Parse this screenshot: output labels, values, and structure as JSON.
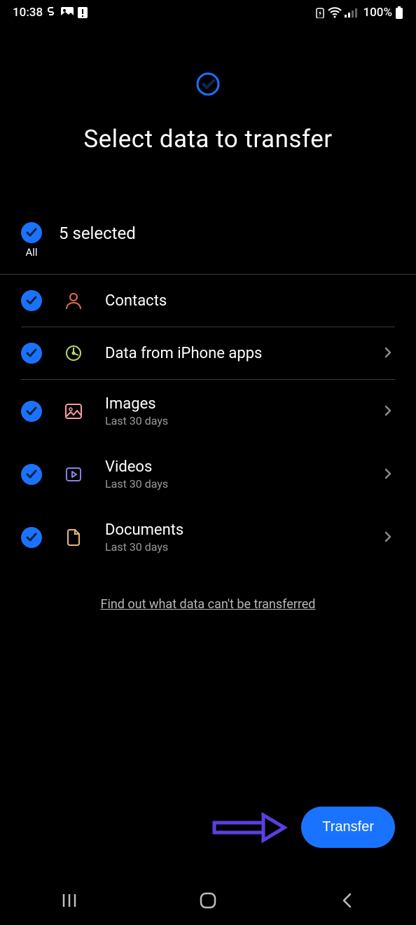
{
  "status": {
    "time": "10:38",
    "battery": "100%"
  },
  "header": {
    "title": "Select data to transfer"
  },
  "all": {
    "label": "All",
    "selected_text": "5 selected"
  },
  "items": [
    {
      "title": "Contacts",
      "sub": "",
      "chevron": false,
      "divider": true,
      "icon_color": "#e06c4e"
    },
    {
      "title": "Data from iPhone apps",
      "sub": "",
      "chevron": true,
      "divider": true,
      "icon_color": "#b8d96a"
    },
    {
      "title": "Images",
      "sub": "Last 30 days",
      "chevron": true,
      "divider": false,
      "icon_color": "#f29ca0"
    },
    {
      "title": "Videos",
      "sub": "Last 30 days",
      "chevron": true,
      "divider": false,
      "icon_color": "#8d7de0"
    },
    {
      "title": "Documents",
      "sub": "Last 30 days",
      "chevron": true,
      "divider": false,
      "icon_color": "#e8b878"
    }
  ],
  "info_link": "Find out what data can't be transferred",
  "cta": {
    "label": "Transfer"
  },
  "colors": {
    "accent": "#1a73ff",
    "annotation": "#5b3fe0"
  }
}
